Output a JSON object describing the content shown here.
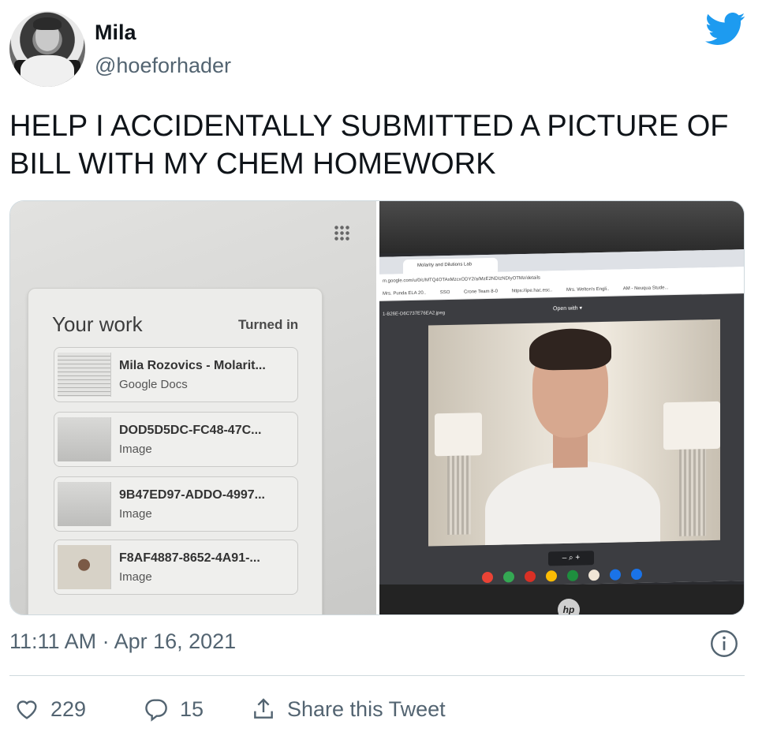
{
  "author": {
    "display_name": "Mila",
    "handle": "@hoeforhader"
  },
  "tweet": {
    "text": "HELP I ACCIDENTALLY SUBMITTED A PICTURE OF BILL WITH MY CHEM HOMEWORK",
    "timestamp": "11:11 AM · Apr 16, 2021"
  },
  "media": {
    "left_photo": {
      "title": "Your work",
      "status": "Turned in",
      "items": [
        {
          "name": "Mila Rozovics - Molarit...",
          "type": "Google Docs"
        },
        {
          "name": "DOD5D5DC-FC48-47C...",
          "type": "Image"
        },
        {
          "name": "9B47ED97-ADDO-4997...",
          "type": "Image"
        },
        {
          "name": "F8AF4887-8652-4A91-...",
          "type": "Image"
        }
      ]
    },
    "right_photo": {
      "tab_title": "Molarity and Dilutions Lab",
      "url": "m.google.com/u/0/c/MTQ4OTAxMzcxODY2/a/MzE2NDIzNDIyOTMz/details",
      "bookmarks": [
        "Mrs. Punda ELA 20..",
        "SSO",
        "Crone Team 8-0",
        "https://ipe.hac.esc..",
        "Mrs. Welton's Engli..",
        "AM - Neuqua Stude..."
      ],
      "file_name": "1-B26E-D6C737E76EA2.jpeg",
      "open_with": "Open with ▾",
      "zoom_controls": "–  ⌕  +",
      "laptop_brand": "hp"
    }
  },
  "actions": {
    "likes": "229",
    "replies": "15",
    "share_label": "Share this Tweet"
  },
  "icons": {
    "twitter": "twitter-bird-icon",
    "info": "info-icon",
    "like": "heart-icon",
    "reply": "reply-bubble-icon",
    "share": "share-icon"
  },
  "colors": {
    "twitter_blue": "#1d9bf0",
    "text_primary": "#0f1419",
    "text_secondary": "#536471",
    "divider": "#cfd9de"
  }
}
